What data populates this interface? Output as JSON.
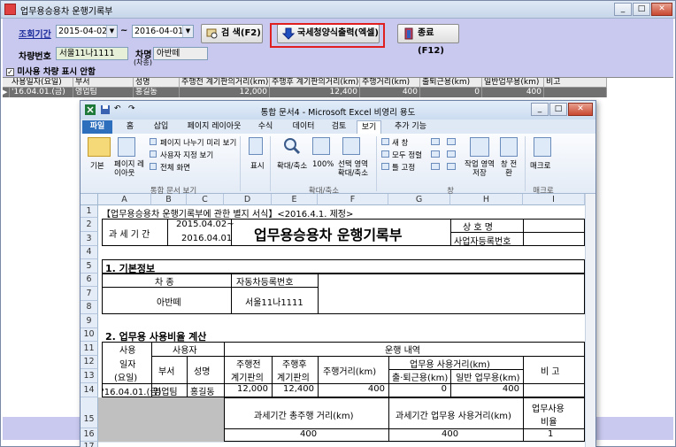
{
  "window": {
    "title": "업무용승용차 운행기록부"
  },
  "filters": {
    "period_label": "조회기간",
    "date_from": "2015-04-02",
    "date_to": "2016-04-01",
    "tilde": "~",
    "car_no_label": "차량번호",
    "car_no_value": "서울11나1111",
    "car_name_label": "차명",
    "car_name_sub": "(차종)",
    "car_name_value": "아반떼",
    "checkbox_label": "미사용 차량 표시 안함",
    "checkbox_mark": "✓"
  },
  "buttons": {
    "search": "검 색(F2)",
    "export": "국세청양식출력(엑셀)",
    "exit": "종료(F12)"
  },
  "grid": {
    "headers": [
      "사용일자(요일)",
      "부서",
      "성명",
      "주행전 계기판의거리(km)",
      "주행후 계기판의거리(km)",
      "주행거리(km)",
      "출퇴근용(km)",
      "일반업무용(km)",
      "비고"
    ],
    "row": {
      "marker": "▶",
      "date": "'16.04.01.(금)",
      "dept": "영업팀",
      "name": "홍길동",
      "before": "12,000",
      "after": "12,400",
      "distance": "400",
      "commute": "0",
      "business": "400",
      "note": ""
    }
  },
  "excel": {
    "title": "통합 문서4 - Microsoft Excel 비영리 용도",
    "tabs": [
      "파일",
      "홈",
      "삽입",
      "페이지 레이아웃",
      "수식",
      "데이터",
      "검토",
      "보기",
      "추가 기능"
    ],
    "ribbon": {
      "normal": "기본",
      "page_layout": "페이지 레이아웃",
      "page_break": "페이지 나누기 미리 보기",
      "custom_view": "사용자 지정 보기",
      "full_screen": "전체 화면",
      "group_views": "통합 문서 보기",
      "show": "표시",
      "zoom": "확대/축소",
      "zoom100": "100%",
      "zoom_sel": "선택 영역 확대/축소",
      "group_zoom": "확대/축소",
      "new_window": "새 창",
      "arrange_all": "모두 정렬",
      "freeze": "틀 고정",
      "group_window": "창",
      "save_ws": "작업 영역 저장",
      "switch_win": "창 전환",
      "macro": "매크로",
      "group_macro": "매크로"
    },
    "columns": [
      "A",
      "B",
      "C",
      "D",
      "E",
      "F",
      "G",
      "H",
      "I"
    ],
    "rows": [
      "1",
      "2",
      "3",
      "4",
      "5",
      "6",
      "7",
      "8",
      "9",
      "10",
      "11",
      "12",
      "13",
      "14",
      "15",
      "16",
      "17"
    ],
    "sheet": {
      "r1": "【업무용승용차 운행기록부에 관한 별지 서식】<2016.4.1. 제정>",
      "period_label": "과 세 기 간",
      "period_from": "2015.04.02~",
      "period_to": "2016.04.01",
      "doc_title": "업무용승용차 운행기록부",
      "company_label": "상   호   명",
      "biz_no_label": "사업자등록번호",
      "sec1": "1. 기본정보",
      "car_type_label": "차    종",
      "reg_no_label": "자동차등록번호",
      "car_type": "아반떼",
      "reg_no": "서울11나1111",
      "sec2": "2. 업무용 사용비율 계산",
      "use_date_1": "사용",
      "use_date_2": "일자",
      "use_date_3": "(요일)",
      "user": "사용자",
      "dept": "부서",
      "name": "성명",
      "run_detail": "운행 내역",
      "before_1": "주행전",
      "before_2": "계기판의",
      "after_1": "주행후",
      "after_2": "계기판의",
      "distance": "주행거리(km)",
      "biz_use": "업무용 사용거리(km)",
      "commute": "출·퇴근용(km)",
      "general": "일반 업무용(km)",
      "note": "비 고",
      "d_date": "'16.04.01.(금)",
      "d_dept": "영업팀",
      "d_name": "홍길동",
      "d_before": "12,000",
      "d_after": "12,400",
      "d_distance": "400",
      "d_commute": "0",
      "d_general": "400",
      "total_run": "과세기간 총주행 거리(km)",
      "total_biz": "과세기간 업무용 사용거리(km)",
      "ratio_1": "업무사용",
      "ratio_2": "비율",
      "t_run": "400",
      "t_biz": "400",
      "t_ratio": "1"
    }
  }
}
